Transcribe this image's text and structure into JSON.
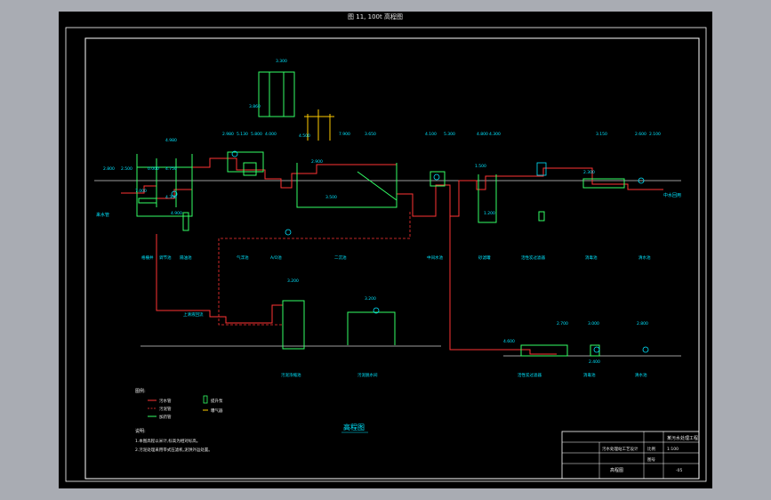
{
  "title_caption": "图 11, 100t 高程图",
  "drawing_title": "高程图",
  "tags": {
    "t1": "3.300",
    "t2": "3.860",
    "t3": "4.980",
    "t4": "2.980",
    "t5": "5.130",
    "t6": "5.800",
    "t7": "4.000",
    "t8": "4.500",
    "t9": "7.900",
    "t10": "3.650",
    "t11": "4.100",
    "t12": "5.300",
    "t13": "4.800",
    "t14": "4.300",
    "t15": "3.150",
    "t16": "2.600",
    "t17": "2.100",
    "t18": "2.800",
    "t19": "2.500",
    "t20": "0.000",
    "t21": "4.750",
    "t22": "7.000",
    "t23": "4.300",
    "t24": "4.900",
    "t25": "2.900",
    "t26": "3.500",
    "t27": "1.500",
    "t28": "1.200",
    "t29": "2.300",
    "t30": "3.200",
    "t31": "3.200",
    "t32": "2.700",
    "t33": "3.000",
    "t34": "2.800",
    "t35": "4.600",
    "t36": "2.400"
  },
  "labels": {
    "inlet": "来水管",
    "outlet": "中水回用",
    "sludge_return": "上清液回流",
    "process": [
      "格栅井",
      "调节池",
      "隔油池",
      "气浮池",
      "A/O池",
      "二沉池",
      "中间水池",
      "砂滤罐",
      "活性炭过滤器",
      "消毒池",
      "清水池"
    ],
    "sludge_units": [
      "污泥浓缩池",
      "污泥脱水间"
    ],
    "lower_units": [
      "活性炭过滤器",
      "消毒池",
      "清水池"
    ]
  },
  "legend": {
    "heading": "图例:",
    "items": [
      "污水管",
      "污泥管",
      "加药管",
      "提升泵",
      "曝气器"
    ]
  },
  "notes": {
    "heading": "说明:",
    "lines": [
      "1.本图高程以米计,标高为相对标高。",
      "2.污泥处理采用带式压滤机,泥饼外运处置。"
    ]
  },
  "title_block": {
    "company": "某污水处理工程",
    "project": "污水处理站工艺设计",
    "drawing": "高程图",
    "scale_label": "比例",
    "scale": "1:100",
    "sheet_label": "图号",
    "sheet": "-05"
  },
  "colors": {
    "background": "#000000",
    "water_pipe": "#ff3333",
    "structure": "#33ff66",
    "label": "#00e5ff",
    "dim": "#00c8ff",
    "text": "#e8e8e8"
  }
}
